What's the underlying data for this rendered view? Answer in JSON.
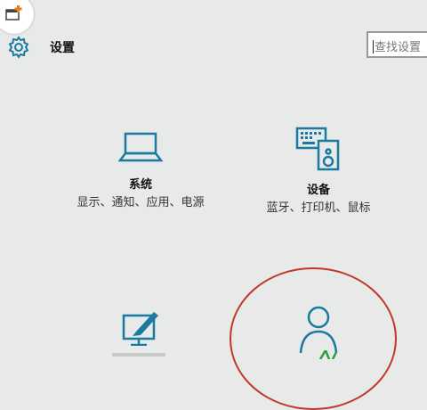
{
  "header": {
    "title": "设置"
  },
  "search": {
    "placeholder": "查找设置"
  },
  "tiles": [
    {
      "name": "系统",
      "desc": "显示、通知、应用、电源",
      "icon": "laptop-icon"
    },
    {
      "name": "设备",
      "desc": "蓝牙、打印机、鼠标",
      "icon": "keyboard-speaker-icon"
    },
    {
      "name": "",
      "desc": "",
      "icon": "personalization-icon"
    },
    {
      "name": "",
      "desc": "",
      "icon": "person-icon"
    }
  ],
  "colors": {
    "accent": "#1a7aa0",
    "background": "#e8eaea",
    "annotation": "#c0392b"
  }
}
